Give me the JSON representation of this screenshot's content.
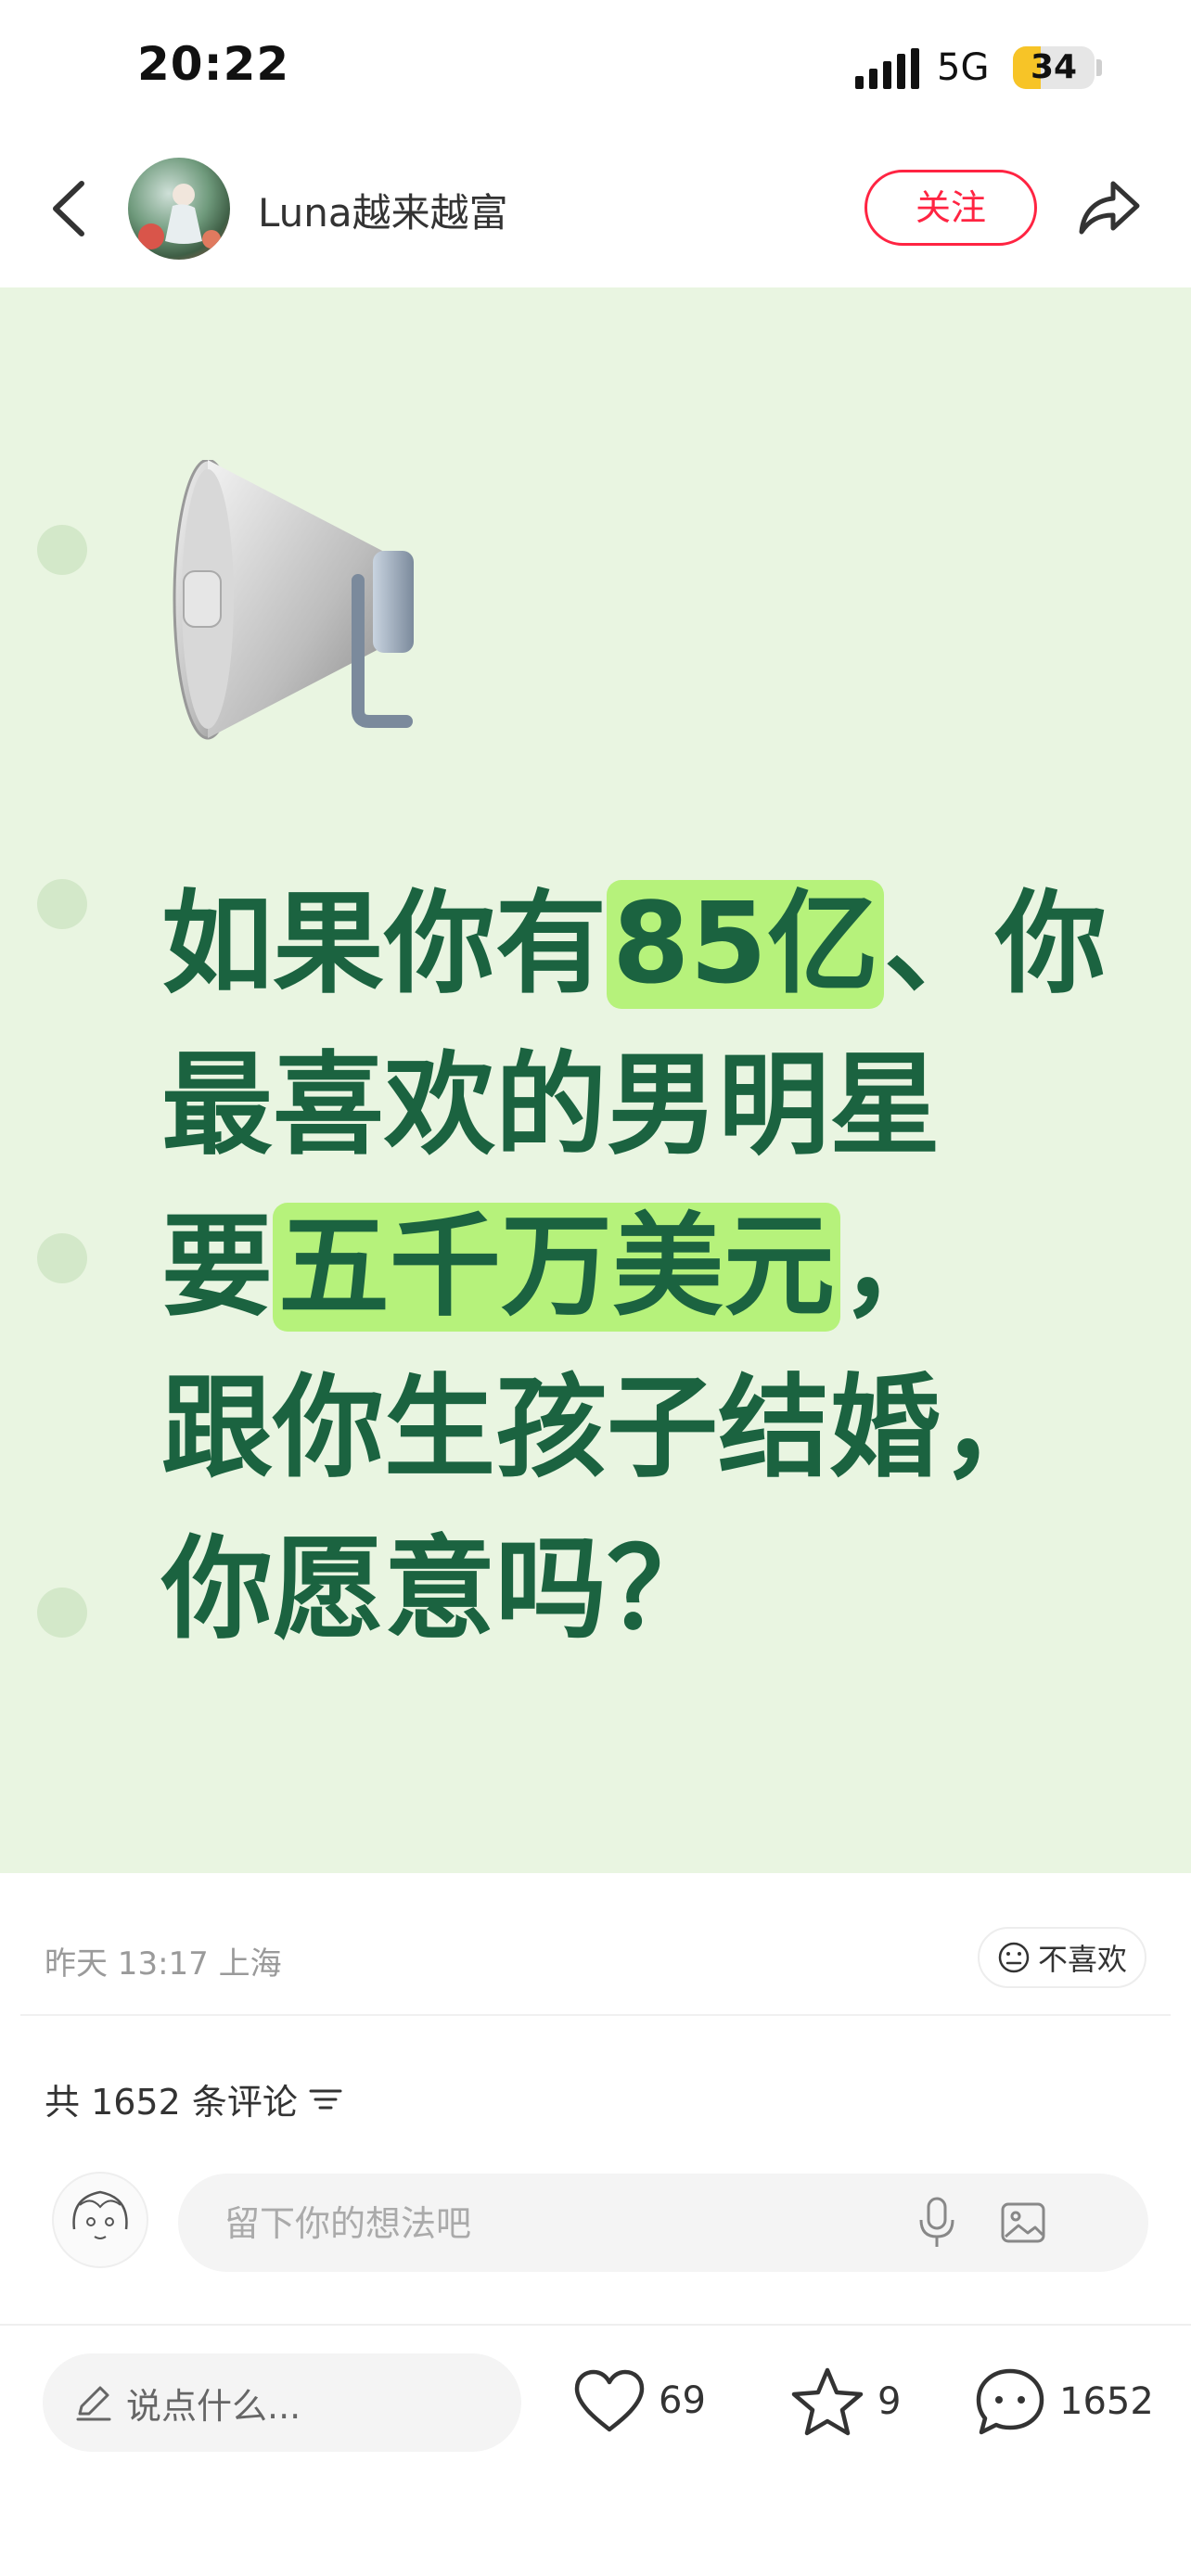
{
  "status_bar": {
    "time": "20:22",
    "network": "5G",
    "battery": "34",
    "battery_level": 0.34
  },
  "header": {
    "author": "Luna越来越富",
    "follow_label": "关注"
  },
  "post": {
    "line1_a": "如果你有",
    "line1_hl": "85亿",
    "line1_b": "、你",
    "line2": "最喜欢的男明星",
    "line3_a": "要",
    "line3_hl": "五千万美元",
    "line3_b": "，",
    "line4": "跟你生孩子结婚，",
    "line5": "你愿意吗？"
  },
  "meta": {
    "time": "昨天 13:17 上海",
    "dislike_label": "不喜欢"
  },
  "comments": {
    "count_label": "共 1652 条评论",
    "placeholder": "留下你的想法吧"
  },
  "bottom_bar": {
    "say_label": "说点什么...",
    "likes": "69",
    "stars": "9",
    "comments": "1652"
  },
  "colors": {
    "accent": "#ff2442",
    "card_bg": "#e9f5e1",
    "text_green": "#1b6340",
    "highlight": "#b6f27b"
  }
}
